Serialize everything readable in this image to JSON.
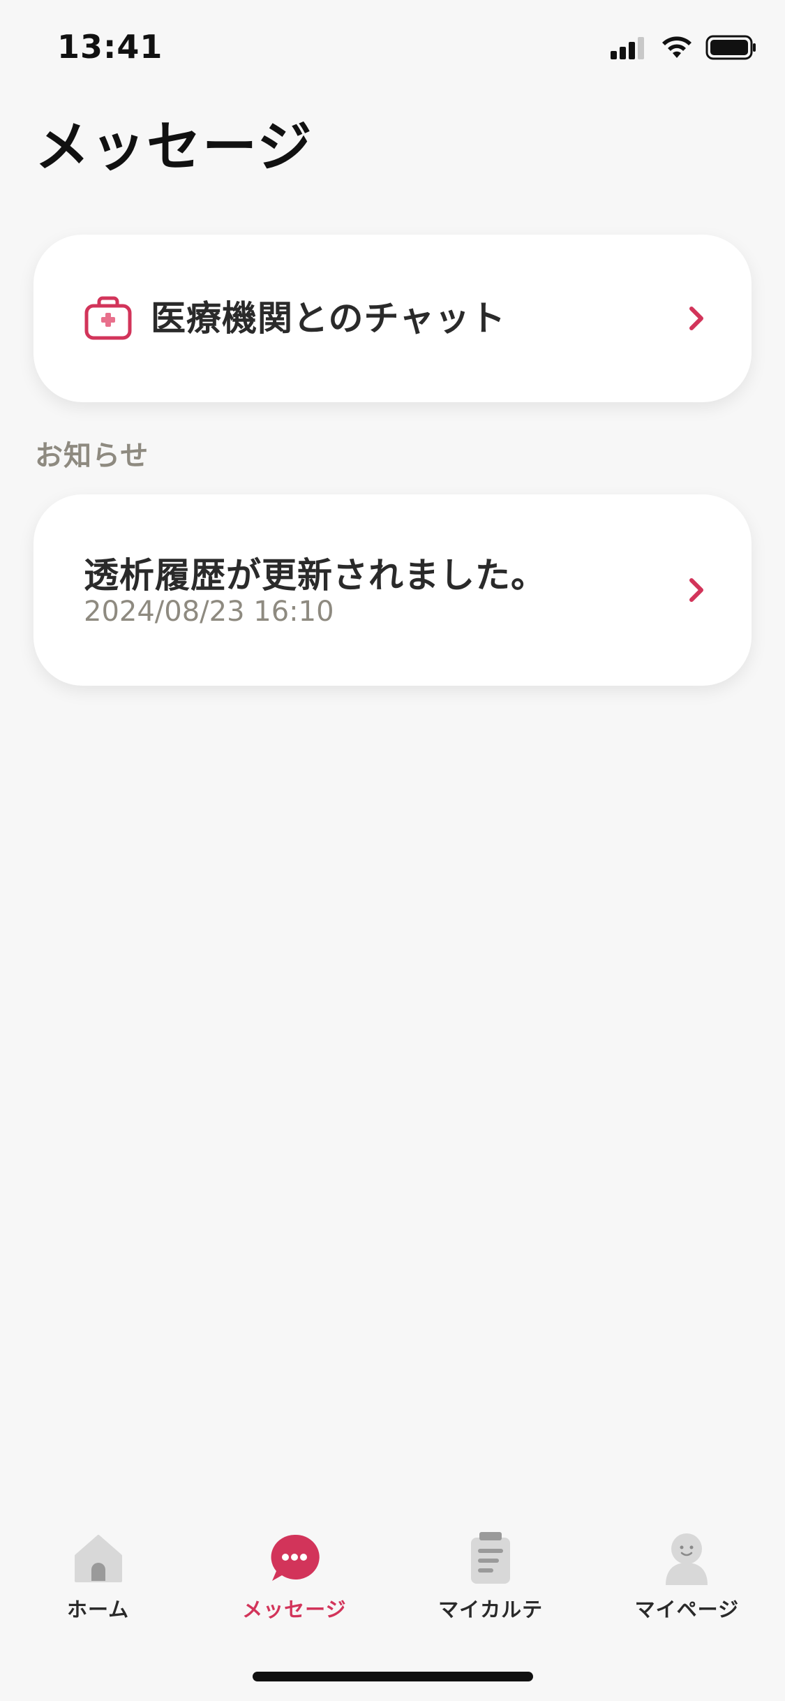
{
  "status_bar": {
    "time": "13:41",
    "icons": [
      "cellular-signal-icon",
      "wifi-icon",
      "battery-icon"
    ]
  },
  "header": {
    "title": "メッセージ"
  },
  "chat_card": {
    "label": "医療機関とのチャット",
    "icon": "medical-bag-icon"
  },
  "notices": {
    "section_label": "お知らせ",
    "items": [
      {
        "title": "透析履歴が更新されました。",
        "datetime": "2024/08/23 16:10"
      }
    ]
  },
  "tab_bar": {
    "items": [
      {
        "label": "ホーム",
        "icon": "home-icon",
        "active": false
      },
      {
        "label": "メッセージ",
        "icon": "chat-bubble-icon",
        "active": true
      },
      {
        "label": "マイカルテ",
        "icon": "clipboard-icon",
        "active": false
      },
      {
        "label": "マイページ",
        "icon": "person-icon",
        "active": false
      }
    ]
  },
  "colors": {
    "accent": "#d2345a",
    "background": "#f7f7f7",
    "card": "#ffffff",
    "muted_text": "#8e8a80",
    "inactive_icon": "#d8d8d8"
  }
}
